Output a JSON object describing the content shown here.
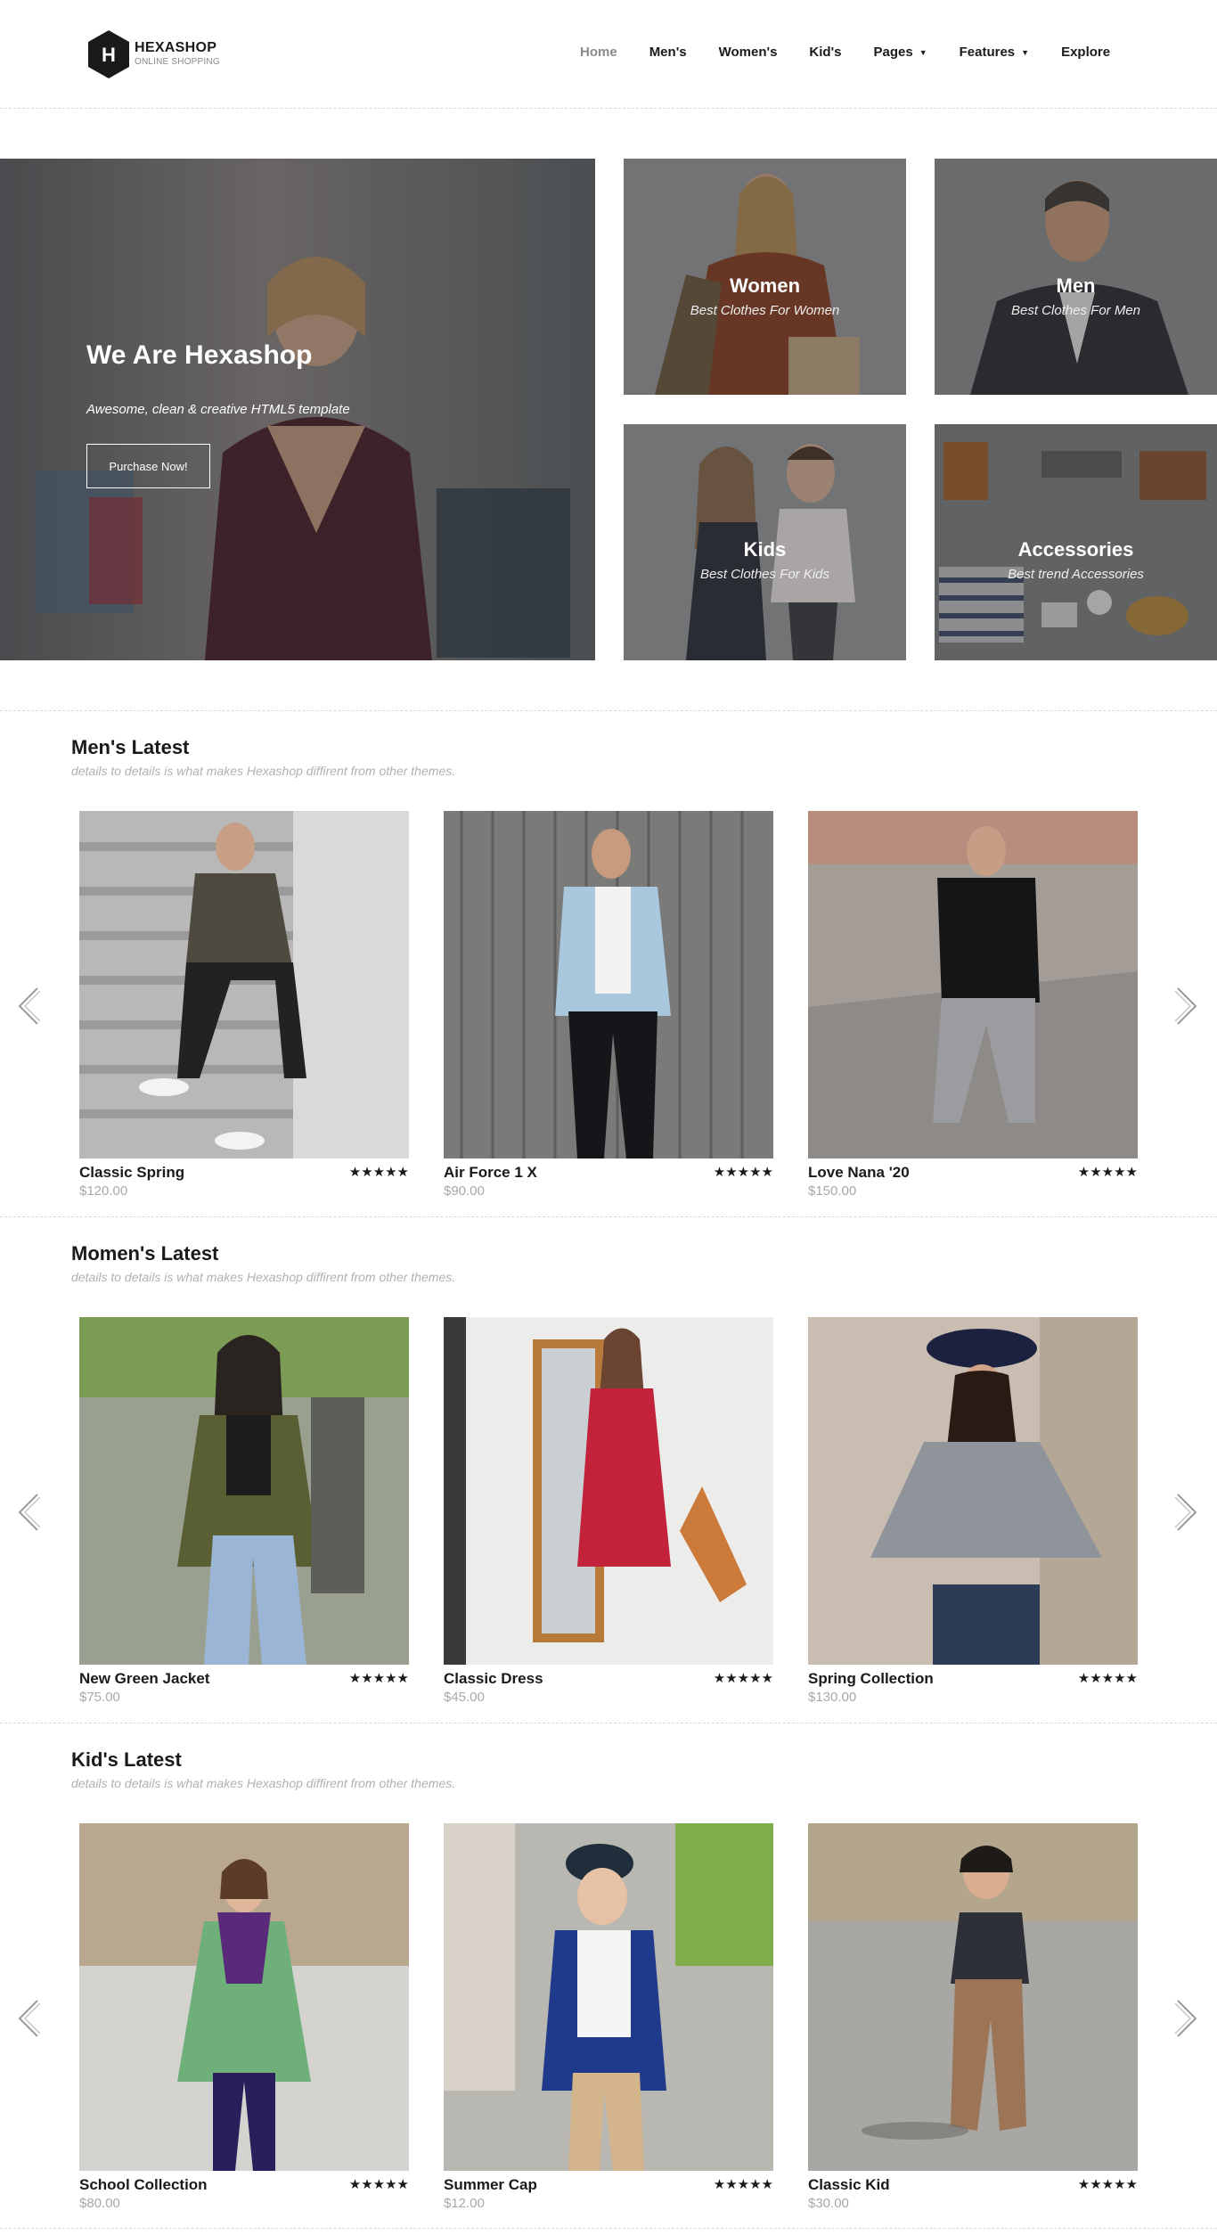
{
  "brand": {
    "name": "HEXASHOP",
    "tagline": "ONLINE SHOPPING",
    "logo_letter": "H"
  },
  "nav": {
    "items": [
      {
        "label": "Home",
        "active": true,
        "dropdown": false
      },
      {
        "label": "Men's",
        "active": false,
        "dropdown": false
      },
      {
        "label": "Women's",
        "active": false,
        "dropdown": false
      },
      {
        "label": "Kid's",
        "active": false,
        "dropdown": false
      },
      {
        "label": "Pages",
        "active": false,
        "dropdown": true
      },
      {
        "label": "Features",
        "active": false,
        "dropdown": true
      },
      {
        "label": "Explore",
        "active": false,
        "dropdown": false
      }
    ],
    "caret": "▼"
  },
  "hero": {
    "title": "We Are Hexashop",
    "subtitle": "Awesome, clean & creative HTML5 template",
    "button": "Purchase Now!"
  },
  "categories": [
    {
      "title": "Women",
      "subtitle": "Best Clothes For Women"
    },
    {
      "title": "Men",
      "subtitle": "Best Clothes For Men"
    },
    {
      "title": "Kids",
      "subtitle": "Best Clothes For Kids"
    },
    {
      "title": "Accessories",
      "subtitle": "Best trend Accessories"
    }
  ],
  "sections": [
    {
      "title": "Men's Latest",
      "subtitle": "details to details is what makes Hexashop diffirent from other themes.",
      "products": [
        {
          "name": "Classic Spring",
          "price": "$120.00",
          "rating": "★★★★★"
        },
        {
          "name": "Air Force 1 X",
          "price": "$90.00",
          "rating": "★★★★★"
        },
        {
          "name": "Love Nana '20",
          "price": "$150.00",
          "rating": "★★★★★"
        }
      ]
    },
    {
      "title": "Momen's Latest",
      "subtitle": "details to details is what makes Hexashop diffirent from other themes.",
      "products": [
        {
          "name": "New Green Jacket",
          "price": "$75.00",
          "rating": "★★★★★"
        },
        {
          "name": "Classic Dress",
          "price": "$45.00",
          "rating": "★★★★★"
        },
        {
          "name": "Spring Collection",
          "price": "$130.00",
          "rating": "★★★★★"
        }
      ]
    },
    {
      "title": "Kid's Latest",
      "subtitle": "details to details is what makes Hexashop diffirent from other themes.",
      "products": [
        {
          "name": "School Collection",
          "price": "$80.00",
          "rating": "★★★★★"
        },
        {
          "name": "Summer Cap",
          "price": "$12.00",
          "rating": "★★★★★"
        },
        {
          "name": "Classic Kid",
          "price": "$30.00",
          "rating": "★★★★★"
        }
      ]
    }
  ],
  "colors": {
    "text": "#1a1a1a",
    "muted": "#a8a8a8",
    "divider": "#d9d9d9",
    "overlay": "#282828"
  }
}
